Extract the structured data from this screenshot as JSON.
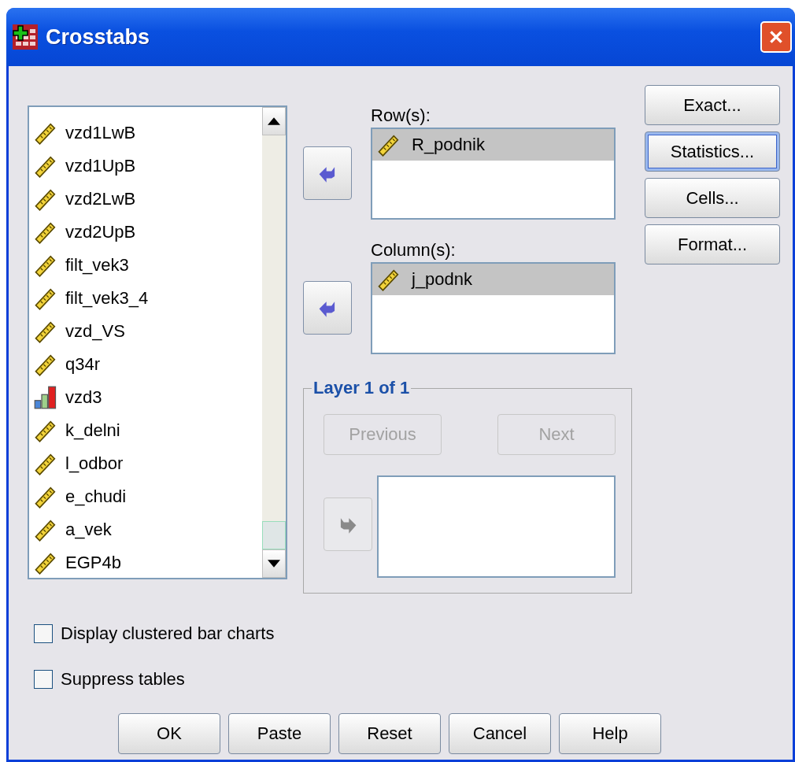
{
  "window": {
    "title": "Crosstabs"
  },
  "variables": [
    {
      "name": "vzd1LwB",
      "kind": "scale"
    },
    {
      "name": "vzd1UpB",
      "kind": "scale"
    },
    {
      "name": "vzd2LwB",
      "kind": "scale"
    },
    {
      "name": "vzd2UpB",
      "kind": "scale"
    },
    {
      "name": "filt_vek3",
      "kind": "scale"
    },
    {
      "name": "filt_vek3_4",
      "kind": "scale"
    },
    {
      "name": "vzd_VS",
      "kind": "scale"
    },
    {
      "name": "q34r",
      "kind": "scale"
    },
    {
      "name": "vzd3",
      "kind": "ordinal"
    },
    {
      "name": "k_delni",
      "kind": "scale"
    },
    {
      "name": "l_odbor",
      "kind": "scale"
    },
    {
      "name": "e_chudi",
      "kind": "scale"
    },
    {
      "name": "a_vek",
      "kind": "scale"
    },
    {
      "name": "EGP4b",
      "kind": "scale"
    }
  ],
  "rows": {
    "label": "Row(s):",
    "items": [
      {
        "name": "R_podnik",
        "kind": "scale",
        "selected": true
      }
    ]
  },
  "columns": {
    "label": "Column(s):",
    "items": [
      {
        "name": "j_podnk",
        "kind": "scale",
        "selected": true
      }
    ]
  },
  "layer": {
    "title": "Layer 1 of 1",
    "previous": {
      "label": "Previous",
      "disabled": true
    },
    "next": {
      "label": "Next",
      "disabled": true
    },
    "arrow_disabled": true
  },
  "side_buttons": [
    {
      "label": "Exact...",
      "focused": false
    },
    {
      "label": "Statistics...",
      "focused": true
    },
    {
      "label": "Cells...",
      "focused": false
    },
    {
      "label": "Format...",
      "focused": false
    }
  ],
  "checkboxes": [
    {
      "label": "Display clustered bar charts",
      "checked": false
    },
    {
      "label": "Suppress tables",
      "checked": false
    }
  ],
  "buttons": [
    "OK",
    "Paste",
    "Reset",
    "Cancel",
    "Help"
  ]
}
